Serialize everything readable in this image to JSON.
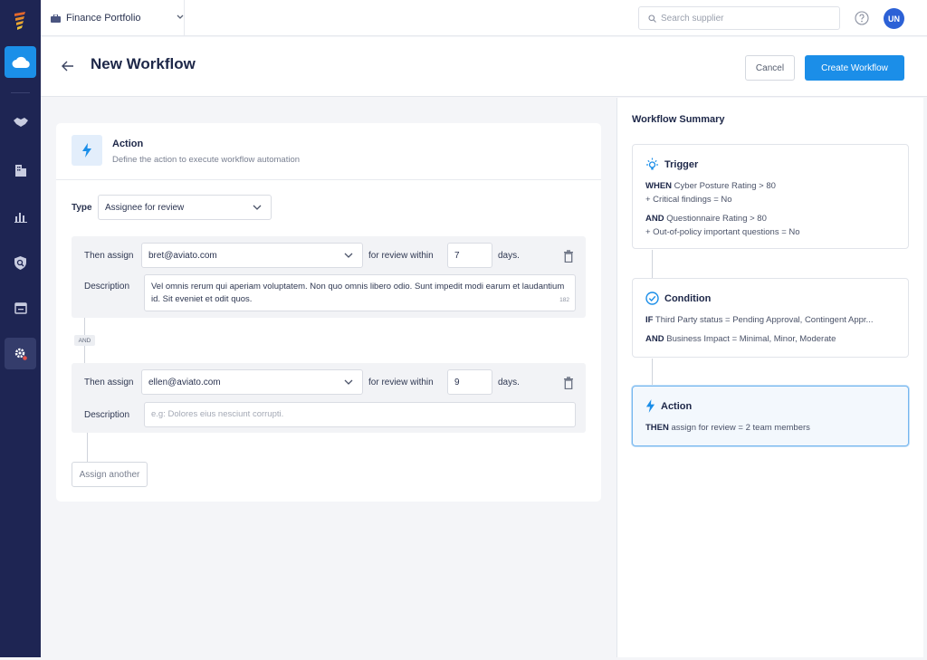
{
  "app": {
    "portfolio": "Finance Portfolio",
    "search_placeholder": "Search supplier",
    "avatar_initials": "UN",
    "sidebar_icons": [
      "logo",
      "cloud-icon",
      "handshake-icon",
      "building-icon",
      "chart-icon",
      "search-shield-icon",
      "calendar-icon",
      "settings-icon"
    ],
    "accent_color": "#1b8ee8",
    "sidebar_color": "#1e2553"
  },
  "header": {
    "title": "New Workflow",
    "cancel_label": "Cancel",
    "create_label": "Create Workflow"
  },
  "action": {
    "title": "Action",
    "subtitle": "Define the action to execute workflow automation",
    "type_label": "Type",
    "type_value": "Assignee for review",
    "assignments": [
      {
        "then_assign_label": "Then assign",
        "assignee": "bret@aviato.com",
        "within_label": "for review within",
        "days": "7",
        "days_label": "days.",
        "description_label": "Description",
        "description": "Vel omnis rerum qui aperiam voluptatem. Non quo omnis libero odio. Sunt impedit modi earum et laudantium id. Sit eveniet et odit quos.",
        "char_count": "182"
      },
      {
        "then_assign_label": "Then assign",
        "assignee": "ellen@aviato.com",
        "within_label": "for review within",
        "days": "9",
        "days_label": "days.",
        "description_label": "Description",
        "description_placeholder": "e.g: Dolores eius nesciunt corrupti."
      }
    ],
    "and_label": "AND",
    "assign_another_label": "Assign another"
  },
  "summary": {
    "title": "Workflow Summary",
    "trigger": {
      "title": "Trigger",
      "line1_kw": "WHEN",
      "line1": "Cyber Posture Rating > 80",
      "line2": "+ Critical findings = No",
      "line3_kw": "AND",
      "line3": "Questionnaire Rating > 80",
      "line4": "+ Out-of-policy important questions = No"
    },
    "condition": {
      "title": "Condition",
      "line1_kw": "IF",
      "line1": "Third Party status = Pending Approval, Contingent Appr...",
      "line2_kw": "AND",
      "line2": "Business Impact = Minimal, Minor, Moderate"
    },
    "action": {
      "title": "Action",
      "line1_kw": "THEN",
      "line1": "assign for review = 2 team members"
    }
  }
}
